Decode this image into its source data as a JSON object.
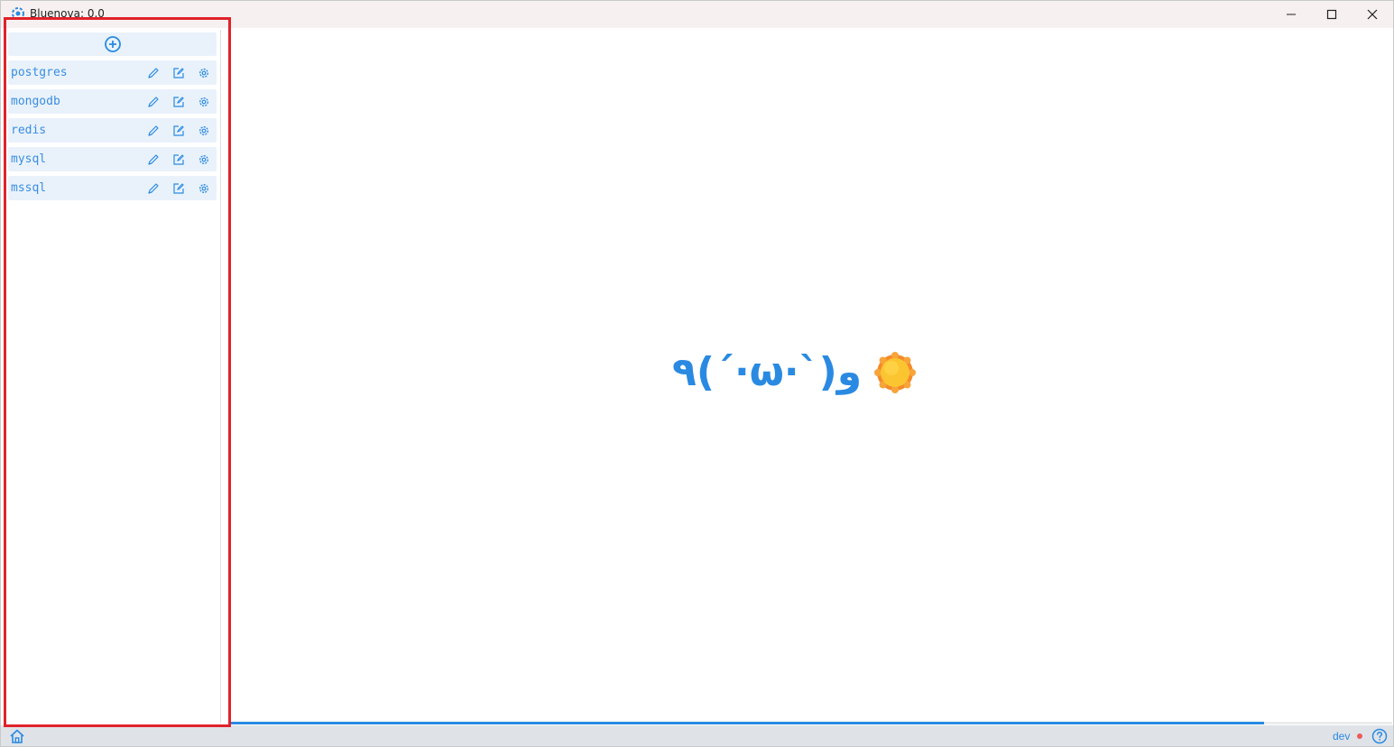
{
  "window": {
    "title": "Bluenova: 0.0"
  },
  "sidebar": {
    "add_button_icon": "plus-circle-icon",
    "connections": [
      {
        "name": "postgres"
      },
      {
        "name": "mongodb"
      },
      {
        "name": "redis"
      },
      {
        "name": "mysql"
      },
      {
        "name": "mssql"
      }
    ],
    "actions": [
      "pencil-icon",
      "edit-square-icon",
      "gear-icon"
    ]
  },
  "main": {
    "greeting_text": "٩(ˊ·ω·ˋ)و",
    "greeting_icon": "sun-icon"
  },
  "progress": {
    "fraction": 0.89
  },
  "statusbar": {
    "env_label": "dev",
    "env_status_color": "#f05a5a"
  },
  "colors": {
    "accent": "#2a8ae2",
    "item_bg": "#e9f2fb",
    "highlight": "#e0222a"
  }
}
